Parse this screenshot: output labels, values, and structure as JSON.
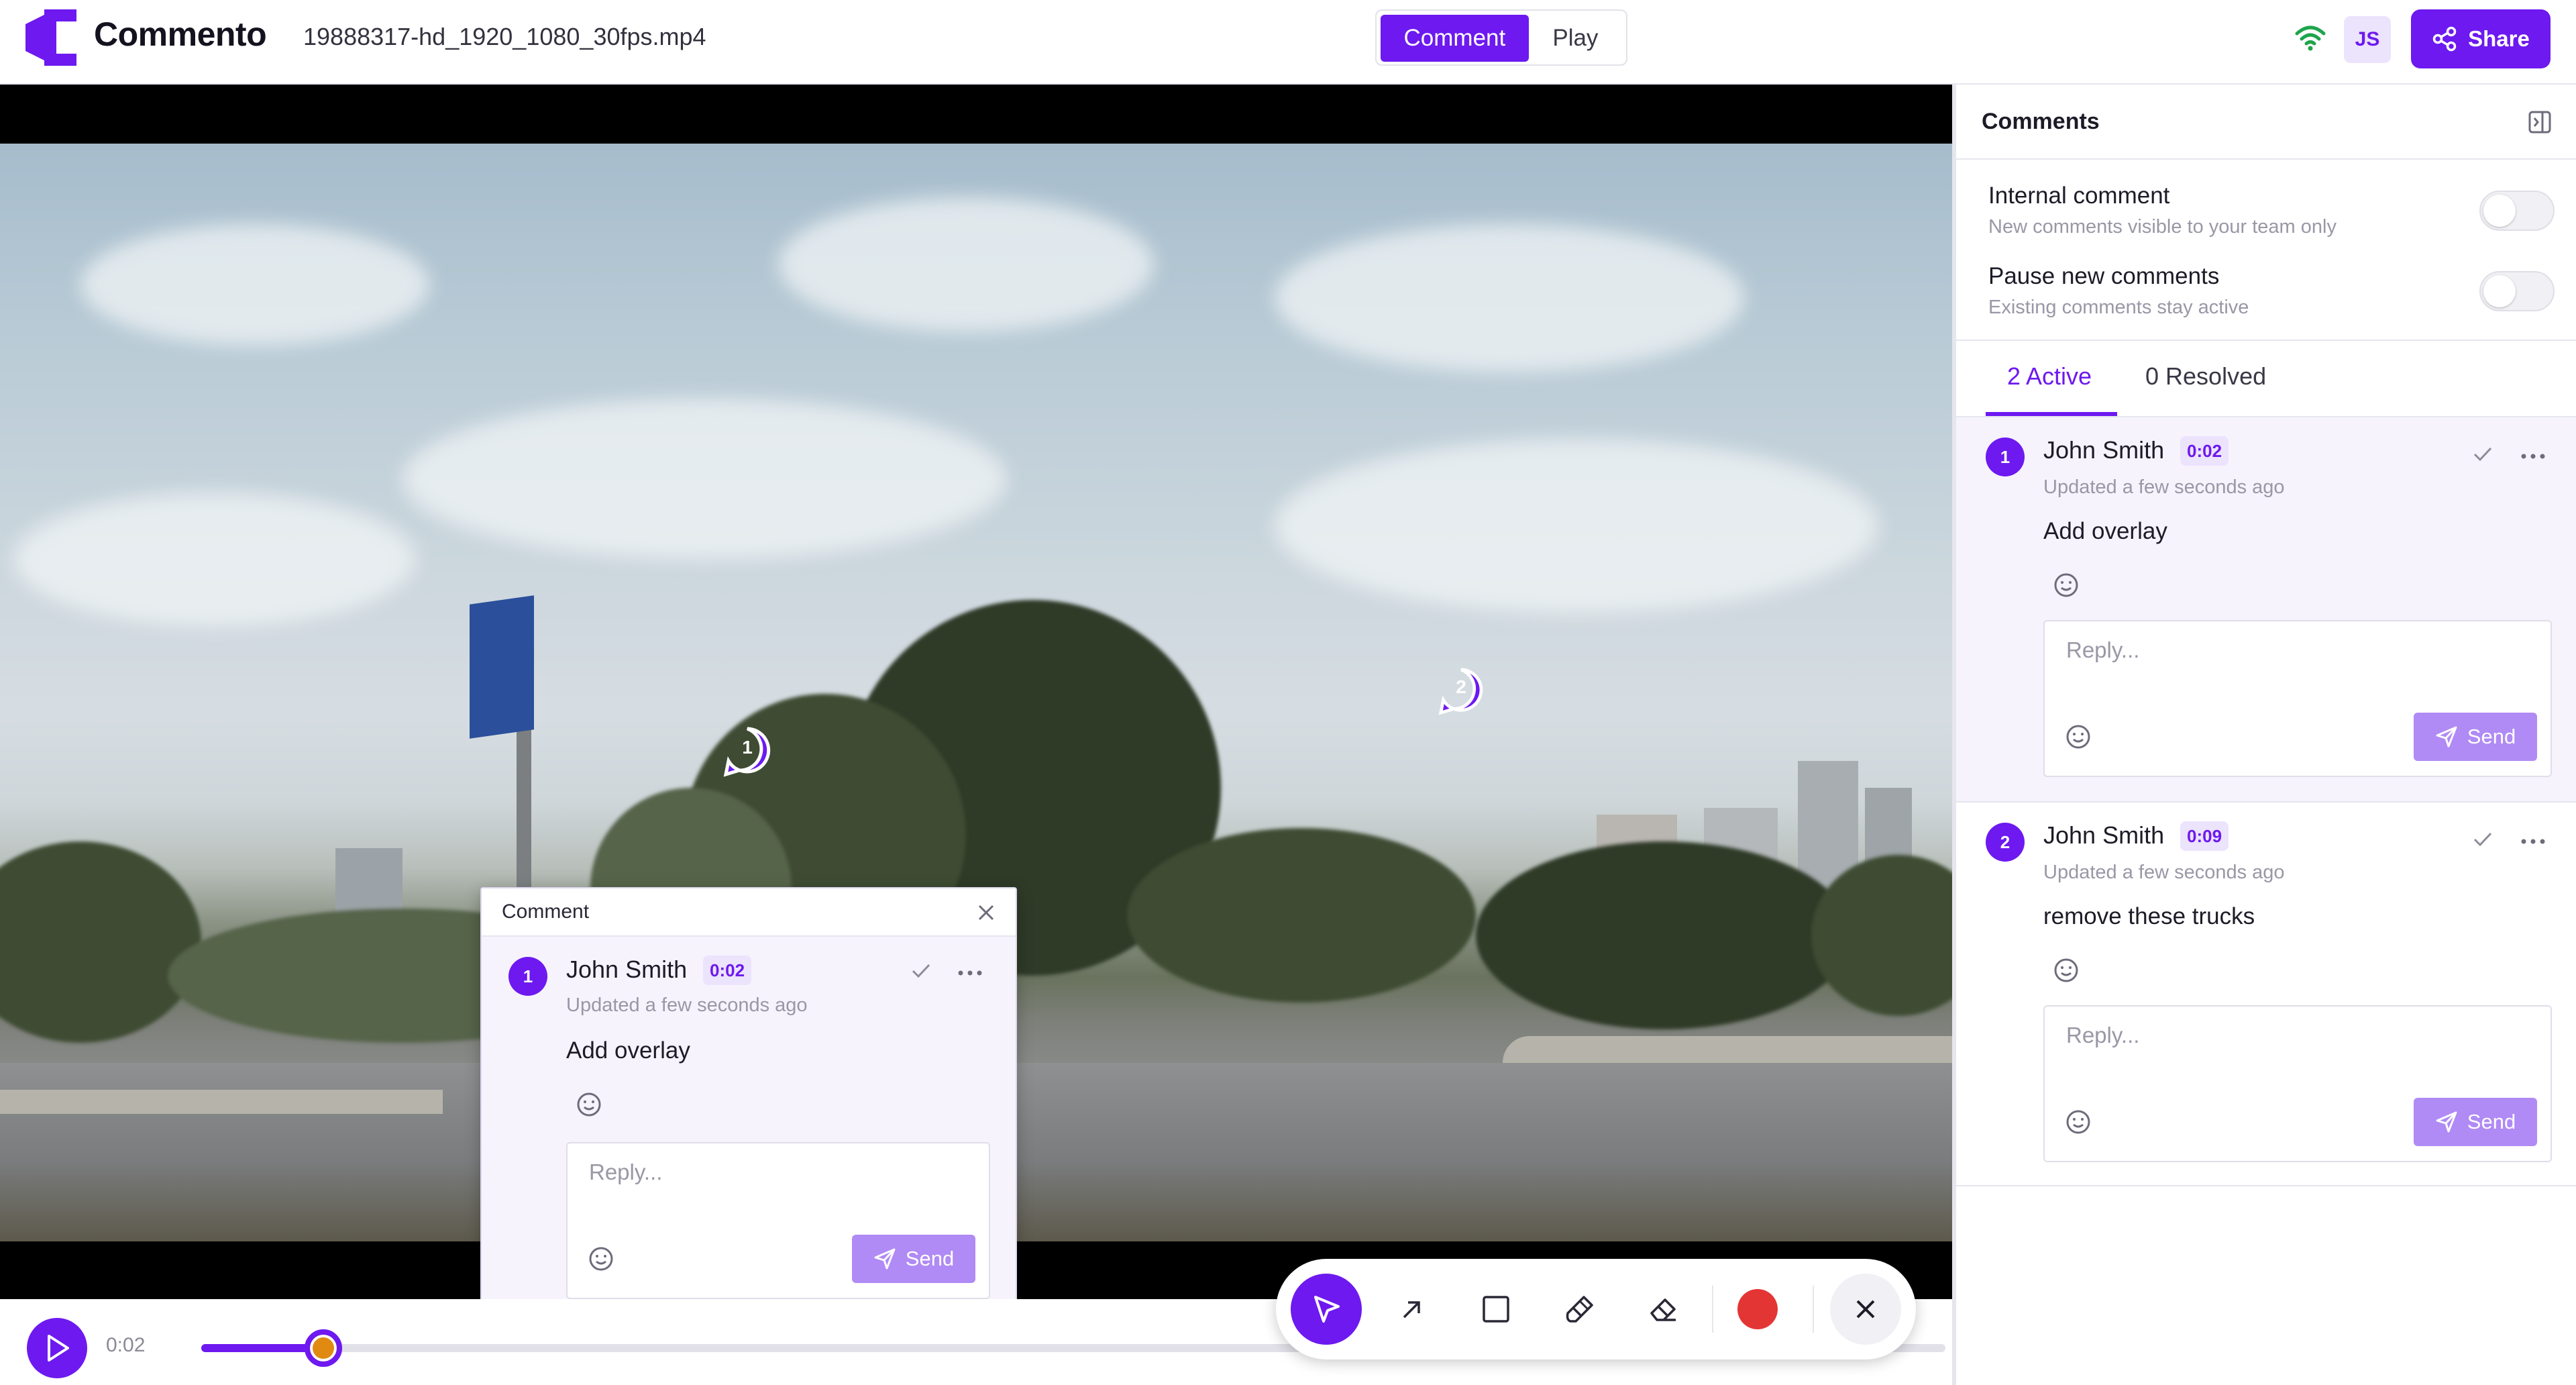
{
  "header": {
    "app_name": "Commento",
    "file_name": "19888317-hd_1920_1080_30fps.mp4",
    "modes": [
      "Comment",
      "Play"
    ],
    "active_mode": "Comment",
    "user_initials": "JS",
    "share_label": "Share",
    "brand_color": "#6d19f0"
  },
  "video": {
    "pins": [
      {
        "number": "1"
      },
      {
        "number": "2"
      }
    ]
  },
  "popup": {
    "title": "Comment",
    "thread": {
      "number": "1",
      "author": "John Smith",
      "timestamp": "0:02",
      "updated": "Updated a few seconds ago",
      "body": "Add overlay",
      "reply_placeholder": "Reply...",
      "send_label": "Send"
    }
  },
  "player": {
    "current_time": "0:02",
    "progress_fraction": 0.07
  },
  "toolbar": {
    "tools": [
      "cursor-icon",
      "arrow-icon",
      "rectangle-icon",
      "brush-icon",
      "eraser-icon"
    ],
    "active_tool": "cursor-icon",
    "color": "#e43535"
  },
  "sidebar": {
    "title": "Comments",
    "settings": [
      {
        "label": "Internal comment",
        "description": "New comments visible to your team only",
        "enabled": false
      },
      {
        "label": "Pause new comments",
        "description": "Existing comments stay active",
        "enabled": false
      }
    ],
    "tabs": [
      {
        "label": "2 Active",
        "active": true
      },
      {
        "label": "0 Resolved",
        "active": false
      }
    ],
    "threads": [
      {
        "number": "1",
        "author": "John Smith",
        "timestamp": "0:02",
        "updated": "Updated a few seconds ago",
        "body": "Add overlay",
        "reply_placeholder": "Reply...",
        "send_label": "Send"
      },
      {
        "number": "2",
        "author": "John Smith",
        "timestamp": "0:09",
        "updated": "Updated a few seconds ago",
        "body": "remove these trucks",
        "reply_placeholder": "Reply...",
        "send_label": "Send"
      }
    ]
  }
}
